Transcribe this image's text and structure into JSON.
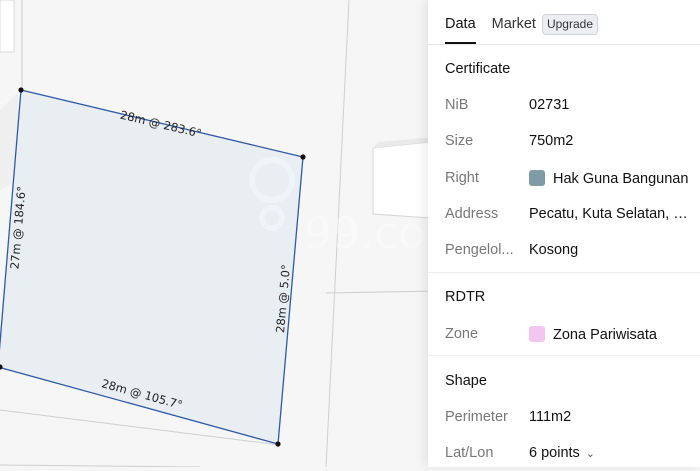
{
  "tabs": [
    {
      "label": "Data",
      "active": true
    },
    {
      "label": "Market",
      "active": false
    }
  ],
  "upgrade_badge": "Upgrade",
  "certificate": {
    "title": "Certificate",
    "rows": [
      {
        "label": "NiB",
        "value": "02731"
      },
      {
        "label": "Size",
        "value": "750m2"
      },
      {
        "label": "Right",
        "value": "Hak Guna Bangunan",
        "swatch": "#7f9ba5"
      },
      {
        "label": "Address",
        "value": "Pecatu, Kuta Selatan, B..."
      },
      {
        "label": "Pengelol...",
        "value": "Kosong"
      }
    ]
  },
  "rdtr": {
    "title": "RDTR",
    "rows": [
      {
        "label": "Zone",
        "value": "Zona Pariwisata",
        "swatch": "#f3c6ef"
      }
    ]
  },
  "shape": {
    "title": "Shape",
    "rows": [
      {
        "label": "Perimeter",
        "value": "111m2"
      },
      {
        "label": "Lat/Lon",
        "value": "6 points"
      }
    ]
  },
  "plot": {
    "edges": [
      {
        "label": "28m @ 283.6°"
      },
      {
        "label": "28m @ 5.0°"
      },
      {
        "label": "28m @ 105.7°"
      },
      {
        "label": "27m @ 184.6°"
      }
    ],
    "fill_color": "#e8edf2",
    "stroke_color": "#2d5aa6"
  },
  "watermark": "99.co"
}
